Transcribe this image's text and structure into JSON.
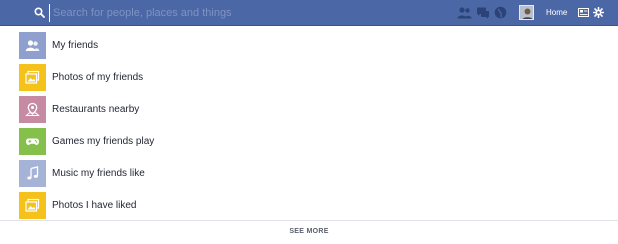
{
  "search": {
    "placeholder": "Search for people, places and things"
  },
  "nav": {
    "home_label": "Home"
  },
  "results": [
    {
      "label": "My friends",
      "icon": "friends-icon",
      "color": "#8fa0cf"
    },
    {
      "label": "Photos of my friends",
      "icon": "photo-icon",
      "color": "#f4c21a"
    },
    {
      "label": "Restaurants nearby",
      "icon": "map-pin-icon",
      "color": "#c78aa3"
    },
    {
      "label": "Games my friends play",
      "icon": "gamepad-icon",
      "color": "#86c04c"
    },
    {
      "label": "Music my friends like",
      "icon": "music-note-icon",
      "color": "#a5b3d6"
    },
    {
      "label": "Photos I have liked",
      "icon": "photo-icon",
      "color": "#f4c21a"
    }
  ],
  "footer": {
    "see_more_label": "SEE MORE"
  },
  "colors": {
    "topbar": "#4b67a6",
    "text": "#1f2430"
  }
}
